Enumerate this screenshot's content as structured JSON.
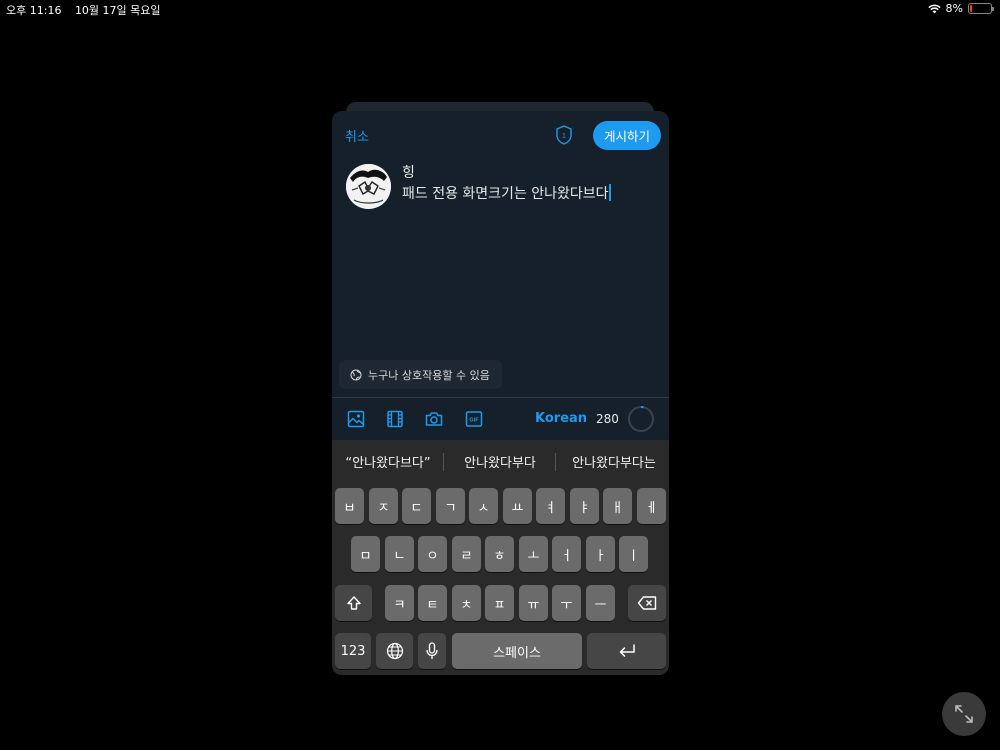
{
  "status_bar": {
    "time": "오후 11:16",
    "date": "10월 17일 목요일",
    "battery": "8%",
    "battery_level": 0.08
  },
  "composer": {
    "cancel_label": "취소",
    "post_label": "게시하기",
    "text_line1": "힝",
    "text_line2": "패드 전용 화면크기는 안나왔다브다",
    "reply_setting": "누구나 상호작용할 수 있음",
    "language": "Korean",
    "char_count": "280",
    "shield_badge": "1"
  },
  "toolbar": {
    "icons": [
      "image-icon",
      "video-icon",
      "camera-icon",
      "gif-icon"
    ]
  },
  "keyboard": {
    "suggestions": [
      "“안나왔다브다”",
      "안나왔다부다",
      "안나왔다부다는"
    ],
    "row1": [
      "ㅂ",
      "ㅈ",
      "ㄷ",
      "ㄱ",
      "ㅅ",
      "ㅛ",
      "ㅕ",
      "ㅑ",
      "ㅐ",
      "ㅔ"
    ],
    "row2": [
      "ㅁ",
      "ㄴ",
      "ㅇ",
      "ㄹ",
      "ㅎ",
      "ㅗ",
      "ㅓ",
      "ㅏ",
      "ㅣ"
    ],
    "row3": [
      "ㅋ",
      "ㅌ",
      "ㅊ",
      "ㅍ",
      "ㅠ",
      "ㅜ",
      "ㅡ"
    ],
    "numbers_label": "123",
    "space_label": "스페이스"
  },
  "colors": {
    "accent": "#1d9bf0",
    "sheet_bg": "#15202b",
    "keyboard_bg": "#2a2a2a",
    "key_bg": "#6b6b6b",
    "key_dark_bg": "#464646"
  }
}
